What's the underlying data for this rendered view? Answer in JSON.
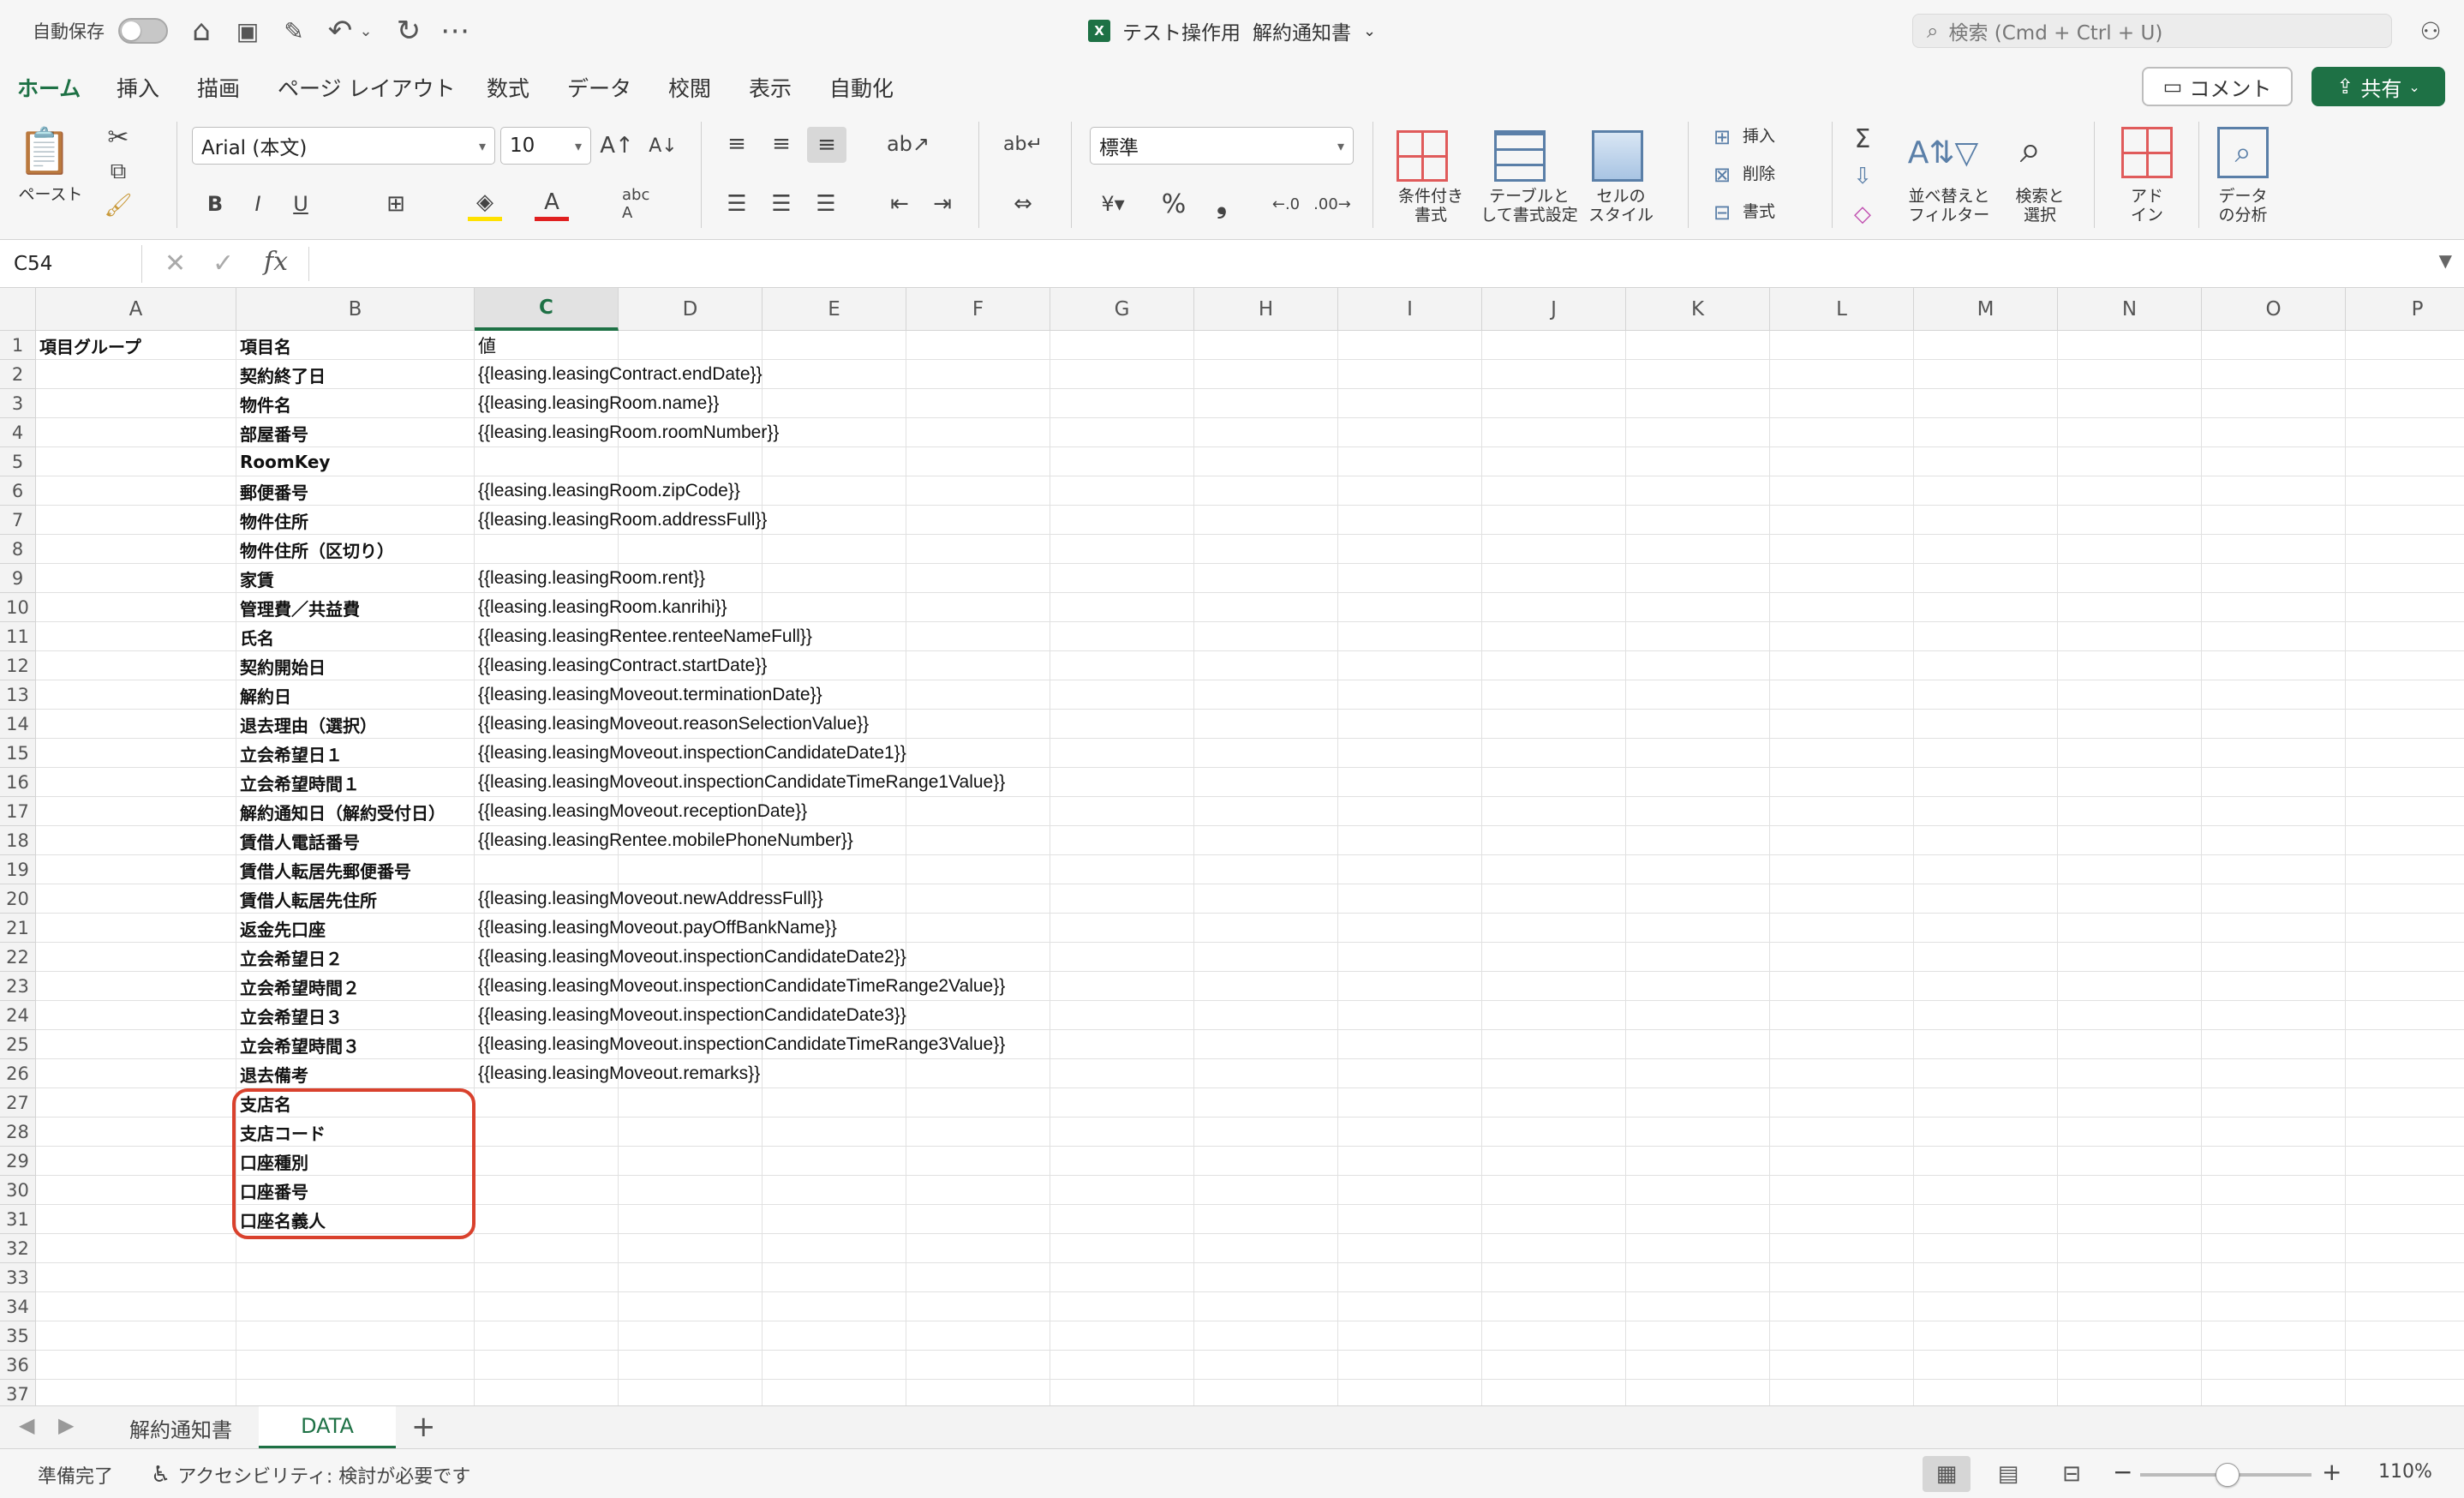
{
  "titlebar": {
    "autosave_label": "自動保存",
    "doc_name": "テスト操作用",
    "doc_file": "解約通知書",
    "search_placeholder": "検索 (Cmd + Ctrl + U)"
  },
  "ribbon_tabs": [
    "ホーム",
    "挿入",
    "描画",
    "ページ レイアウト",
    "数式",
    "データ",
    "校閲",
    "表示",
    "自動化"
  ],
  "ribbon_actions": {
    "comment": "コメント",
    "share": "共有"
  },
  "ribbon": {
    "paste_label": "ペースト",
    "font_name": "Arial (本文)",
    "font_size": "10",
    "number_format": "標準",
    "conditional_format": "条件付き\n書式",
    "table_format": "テーブルと\nして書式設定",
    "cell_style": "セルの\nスタイル",
    "insert_label": "挿入",
    "delete_label": "削除",
    "format_label": "書式",
    "sort_filter": "並べ替えと\nフィルター",
    "find_select": "検索と\n選択",
    "addin": "アド\nイン",
    "data_analysis": "データ\nの分析"
  },
  "formula_bar": {
    "name_box": "C54",
    "formula": ""
  },
  "sheet": {
    "columns": [
      "A",
      "B",
      "C",
      "D",
      "E",
      "F",
      "G",
      "H",
      "I",
      "J",
      "K",
      "L",
      "M",
      "N",
      "O",
      "P"
    ],
    "selected_column": "C",
    "rows": [
      {
        "n": "1",
        "a": "項目グループ",
        "b": "項目名",
        "c": "値"
      },
      {
        "n": "2",
        "a": "",
        "b": "契約終了日",
        "c": "{{leasing.leasingContract.endDate}}"
      },
      {
        "n": "3",
        "a": "",
        "b": "物件名",
        "c": "{{leasing.leasingRoom.name}}"
      },
      {
        "n": "4",
        "a": "",
        "b": "部屋番号",
        "c": "{{leasing.leasingRoom.roomNumber}}"
      },
      {
        "n": "5",
        "a": "",
        "b": "RoomKey",
        "c": ""
      },
      {
        "n": "6",
        "a": "",
        "b": "郵便番号",
        "c": "{{leasing.leasingRoom.zipCode}}"
      },
      {
        "n": "7",
        "a": "",
        "b": "物件住所",
        "c": "{{leasing.leasingRoom.addressFull}}"
      },
      {
        "n": "8",
        "a": "",
        "b": "物件住所（区切り）",
        "c": ""
      },
      {
        "n": "9",
        "a": "",
        "b": "家賃",
        "c": "{{leasing.leasingRoom.rent}}"
      },
      {
        "n": "10",
        "a": "",
        "b": "管理費／共益費",
        "c": "{{leasing.leasingRoom.kanrihi}}"
      },
      {
        "n": "11",
        "a": "",
        "b": "氏名",
        "c": "{{leasing.leasingRentee.renteeNameFull}}"
      },
      {
        "n": "12",
        "a": "",
        "b": "契約開始日",
        "c": "{{leasing.leasingContract.startDate}}"
      },
      {
        "n": "13",
        "a": "",
        "b": "解約日",
        "c": "{{leasing.leasingMoveout.terminationDate}}"
      },
      {
        "n": "14",
        "a": "",
        "b": "退去理由（選択）",
        "c": "{{leasing.leasingMoveout.reasonSelectionValue}}"
      },
      {
        "n": "15",
        "a": "",
        "b": "立会希望日１",
        "c": "{{leasing.leasingMoveout.inspectionCandidateDate1}}"
      },
      {
        "n": "16",
        "a": "",
        "b": "立会希望時間１",
        "c": "{{leasing.leasingMoveout.inspectionCandidateTimeRange1Value}}"
      },
      {
        "n": "17",
        "a": "",
        "b": "解約通知日（解約受付日）",
        "c": "{{leasing.leasingMoveout.receptionDate}}"
      },
      {
        "n": "18",
        "a": "",
        "b": "賃借人電話番号",
        "c": "{{leasing.leasingRentee.mobilePhoneNumber}}"
      },
      {
        "n": "19",
        "a": "",
        "b": "賃借人転居先郵便番号",
        "c": ""
      },
      {
        "n": "20",
        "a": "",
        "b": "賃借人転居先住所",
        "c": "{{leasing.leasingMoveout.newAddressFull}}"
      },
      {
        "n": "21",
        "a": "",
        "b": "返金先口座",
        "c": "{{leasing.leasingMoveout.payOffBankName}}"
      },
      {
        "n": "22",
        "a": "",
        "b": "立会希望日２",
        "c": "{{leasing.leasingMoveout.inspectionCandidateDate2}}"
      },
      {
        "n": "23",
        "a": "",
        "b": "立会希望時間２",
        "c": "{{leasing.leasingMoveout.inspectionCandidateTimeRange2Value}}"
      },
      {
        "n": "24",
        "a": "",
        "b": "立会希望日３",
        "c": "{{leasing.leasingMoveout.inspectionCandidateDate3}}"
      },
      {
        "n": "25",
        "a": "",
        "b": "立会希望時間３",
        "c": "{{leasing.leasingMoveout.inspectionCandidateTimeRange3Value}}"
      },
      {
        "n": "26",
        "a": "",
        "b": "退去備考",
        "c": "{{leasing.leasingMoveout.remarks}}"
      },
      {
        "n": "27",
        "a": "",
        "b": "支店名",
        "c": ""
      },
      {
        "n": "28",
        "a": "",
        "b": "支店コード",
        "c": ""
      },
      {
        "n": "29",
        "a": "",
        "b": "口座種別",
        "c": ""
      },
      {
        "n": "30",
        "a": "",
        "b": "口座番号",
        "c": ""
      },
      {
        "n": "31",
        "a": "",
        "b": "口座名義人",
        "c": ""
      },
      {
        "n": "32",
        "a": "",
        "b": "",
        "c": ""
      },
      {
        "n": "33",
        "a": "",
        "b": "",
        "c": ""
      },
      {
        "n": "34",
        "a": "",
        "b": "",
        "c": ""
      },
      {
        "n": "35",
        "a": "",
        "b": "",
        "c": ""
      },
      {
        "n": "36",
        "a": "",
        "b": "",
        "c": ""
      },
      {
        "n": "37",
        "a": "",
        "b": "",
        "c": ""
      }
    ]
  },
  "sheet_tabs": [
    "解約通知書",
    "DATA"
  ],
  "active_sheet": "DATA",
  "status": {
    "ready": "準備完了",
    "accessibility": "アクセシビリティ: 検討が必要です",
    "zoom": "110%"
  },
  "colors": {
    "accent": "#1e7145",
    "highlight_box": "#d9412d"
  }
}
